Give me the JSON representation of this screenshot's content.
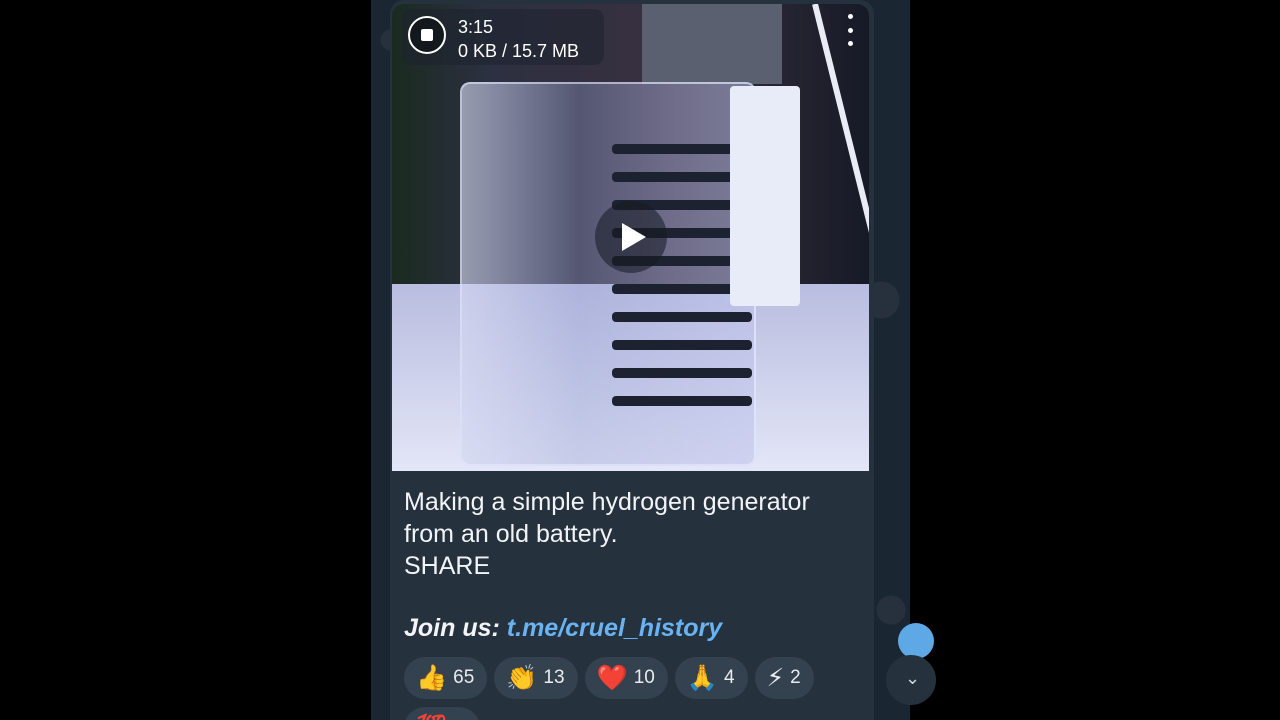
{
  "video": {
    "duration": "3:15",
    "download_progress": "0 KB / 15.7 MB"
  },
  "message": {
    "caption_line1": "Making a simple hydrogen generator",
    "caption_line2": "from an old battery.",
    "caption_line3": "SHARE",
    "join_label": "Join us:",
    "join_link": "t.me/cruel_history"
  },
  "reactions": [
    {
      "emoji": "👍",
      "count": "65"
    },
    {
      "emoji": "👏",
      "count": "13"
    },
    {
      "emoji": "❤️",
      "count": "10"
    },
    {
      "emoji": "🙏",
      "count": "4"
    },
    {
      "emoji": "⚡",
      "count": "2"
    },
    {
      "emoji": "💯",
      "count": ""
    }
  ],
  "colors": {
    "link": "#6ab3f3",
    "bubble": "#25313d",
    "reaction_bg": "#34414f"
  }
}
